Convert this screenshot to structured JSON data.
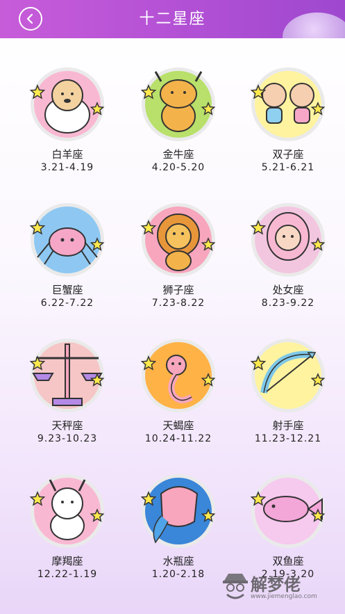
{
  "header": {
    "title": "十二星座",
    "back_icon": "chevron-left-icon",
    "gradient_start": "#c75cd9",
    "gradient_end": "#9e48cf"
  },
  "signs": [
    {
      "name": "白羊座",
      "dates": "3.21-4.19",
      "bg": "#f9b8d2",
      "icon": "ram-icon"
    },
    {
      "name": "金牛座",
      "dates": "4.20-5.20",
      "bg": "#b8e06a",
      "icon": "bull-icon"
    },
    {
      "name": "双子座",
      "dates": "5.21-6.21",
      "bg": "#fff3a0",
      "icon": "twins-icon"
    },
    {
      "name": "巨蟹座",
      "dates": "6.22-7.22",
      "bg": "#8ec8f2",
      "icon": "crab-icon"
    },
    {
      "name": "狮子座",
      "dates": "7.23-8.22",
      "bg": "#f7a6bd",
      "icon": "lion-icon"
    },
    {
      "name": "处女座",
      "dates": "8.23-9.22",
      "bg": "#f3c6e0",
      "icon": "maiden-icon"
    },
    {
      "name": "天秤座",
      "dates": "9.23-10.23",
      "bg": "#f6c6c6",
      "icon": "scales-icon"
    },
    {
      "name": "天蝎座",
      "dates": "10.24-11.22",
      "bg": "#ffb246",
      "icon": "scorpion-icon"
    },
    {
      "name": "射手座",
      "dates": "11.23-12.21",
      "bg": "#fff3a0",
      "icon": "archer-icon"
    },
    {
      "name": "摩羯座",
      "dates": "12.22-1.19",
      "bg": "#f9b8d2",
      "icon": "goat-icon"
    },
    {
      "name": "水瓶座",
      "dates": "1.20-2.18",
      "bg": "#3a86d8",
      "icon": "water-bearer-icon"
    },
    {
      "name": "双鱼座",
      "dates": "2.19-3.20",
      "bg": "#f6c9ee",
      "icon": "fish-icon"
    }
  ],
  "watermark": {
    "text": "解梦佬",
    "url": "www.jiemenglao.com"
  }
}
